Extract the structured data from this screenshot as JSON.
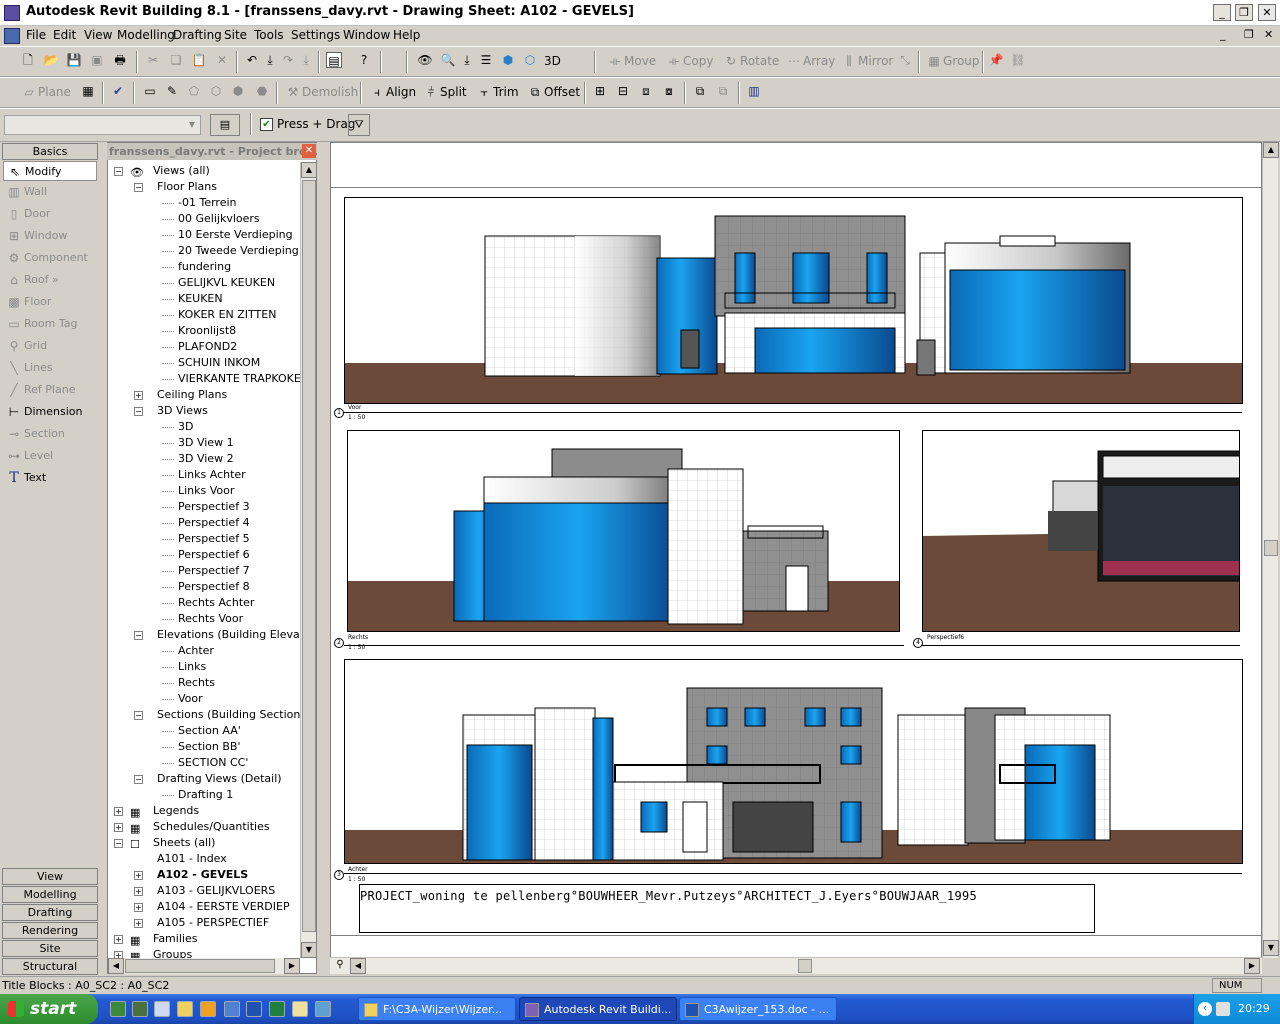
{
  "window": {
    "title": "Autodesk Revit Building 8.1 - [franssens_davy.rvt - Drawing Sheet: A102 - GEVELS]"
  },
  "menu": [
    "File",
    "Edit",
    "View",
    "Modelling",
    "Drafting",
    "Site",
    "Tools",
    "Settings",
    "Window",
    "Help"
  ],
  "toolbar1": {
    "view_3d_label": "3D",
    "move": "Move",
    "copy": "Copy",
    "rotate": "Rotate",
    "array": "Array",
    "mirror": "Mirror",
    "group": "Group"
  },
  "toolbar2": {
    "plane": "Plane",
    "demolish": "Demolish",
    "align": "Align",
    "split": "Split",
    "trim": "Trim",
    "offset": "Offset"
  },
  "optionsbar": {
    "press_drag_label": "Press + Drag",
    "press_drag_checked": true
  },
  "designbar": {
    "header": "Basics",
    "items": [
      "Modify",
      "Wall",
      "Door",
      "Window",
      "Component",
      "Roof »",
      "Floor",
      "Room Tag",
      "Grid",
      "Lines",
      "Ref Plane",
      "Dimension",
      "Section",
      "Level",
      "Text"
    ],
    "tabs": [
      "View",
      "Modelling",
      "Drafting",
      "Rendering",
      "Site",
      "Structural"
    ]
  },
  "project_browser": {
    "title": "franssens_davy.rvt - Project bro...",
    "root": "Views (all)",
    "floor_plans": {
      "label": "Floor Plans",
      "items": [
        "-01 Terrein",
        "00 Gelijkvloers",
        "10 Eerste Verdieping",
        "20 Tweede Verdieping",
        "fundering",
        "GELIJKVL KEUKEN",
        "KEUKEN",
        "KOKER  EN ZITTEN",
        "Kroonlijst8",
        "PLAFOND2",
        "SCHUIN INKOM",
        "VIERKANTE TRAPKOKE"
      ]
    },
    "ceiling_plans": "Ceiling Plans",
    "views_3d": {
      "label": "3D Views",
      "items": [
        "3D",
        "3D View 1",
        "3D View 2",
        "Links Achter",
        "Links Voor",
        "Perspectief 3",
        "Perspectief 4",
        "Perspectief 5",
        "Perspectief 6",
        "Perspectief 7",
        "Perspectief 8",
        "Rechts Achter",
        "Rechts Voor"
      ]
    },
    "elevations": {
      "label": "Elevations (Building Elevation",
      "items": [
        "Achter",
        "Links",
        "Rechts",
        "Voor"
      ]
    },
    "sections": {
      "label": "Sections (Building Section)",
      "items": [
        "Section AA'",
        "Section BB'",
        "SECTION CC'"
      ]
    },
    "drafting": {
      "label": "Drafting Views (Detail)",
      "items": [
        "Drafting 1"
      ]
    },
    "legends": "Legends",
    "schedules": "Schedules/Quantities",
    "sheets": {
      "label": "Sheets (all)",
      "items": [
        "A101 - Index",
        "A102 - GEVELS",
        "A103 - GELIJKVLOERS",
        "A104 - EERSTE VERDIEP",
        "A105 - PERSPECTIEF"
      ]
    },
    "families": "Families",
    "groups": "Groups"
  },
  "sheet": {
    "views": [
      {
        "num": "1",
        "name": "Voor",
        "scale": "1 : 50"
      },
      {
        "num": "2",
        "name": "Rechts",
        "scale": "1 : 50"
      },
      {
        "num": "4",
        "name": "Perspectief6",
        "scale": ""
      },
      {
        "num": "3",
        "name": "Achter",
        "scale": "1 : 50"
      }
    ],
    "titleblock_text": "PROJECT_woning te pellenberg°BOUWHEER_Mevr.Putzeys°ARCHITECT_J.Eyers°BOUWJAAR_1995"
  },
  "status": {
    "text": "Title Blocks : A0_SC2 : A0_SC2",
    "num": "NUM"
  },
  "taskbar": {
    "start": "start",
    "tasks": [
      "F:\\C3A-Wijzer\\Wijzer...",
      "Autodesk Revit Buildi...",
      "C3Awijzer_153.doc - ..."
    ],
    "clock": "20:29"
  },
  "colors": {
    "glass": "#1a9ae8",
    "ground": "#6b4a3a",
    "panel": "#8c8c8c"
  }
}
